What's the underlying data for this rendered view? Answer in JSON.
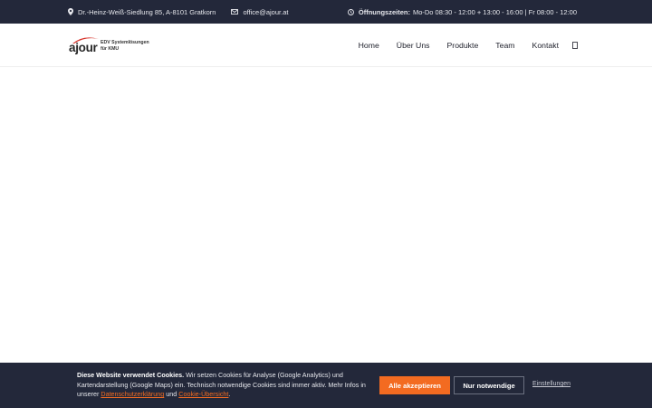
{
  "topbar": {
    "address": "Dr.-Heinz-Weiß-Siedlung 85, A-8101 Gratkorn",
    "email": "office@ajour.at",
    "hours_label": "Öffnungszeiten:",
    "hours_value": "Mo-Do 08:30 - 12:00 + 13:00 - 16:00 | Fr 08:00 - 12:00"
  },
  "logo": {
    "word": "ajour",
    "tagline_1": "EDV Systemlösungen",
    "tagline_2": "für KMU"
  },
  "nav": {
    "items": [
      "Home",
      "Über Uns",
      "Produkte",
      "Team",
      "Kontakt"
    ],
    "search_icon": "search-icon"
  },
  "cookie": {
    "title": "Diese Website verwendet Cookies.",
    "text_1": " Wir setzen Cookies für Analyse (Google Analytics) und Kartendarstellung (Google Maps) ein. Technisch notwendige Cookies sind immer aktiv. Mehr Infos in unserer ",
    "privacy_link": "Datenschutzerklärung",
    "text_2": " und ",
    "overview_link": "Cookie-Übersicht",
    "text_3": ".",
    "accept_label": "Alle akzeptieren",
    "necessary_label": "Nur notwendige",
    "settings_label": "Einstellungen"
  },
  "colors": {
    "dark": "#23283a",
    "accent": "#f36b21",
    "logo_red": "#d7322a"
  }
}
